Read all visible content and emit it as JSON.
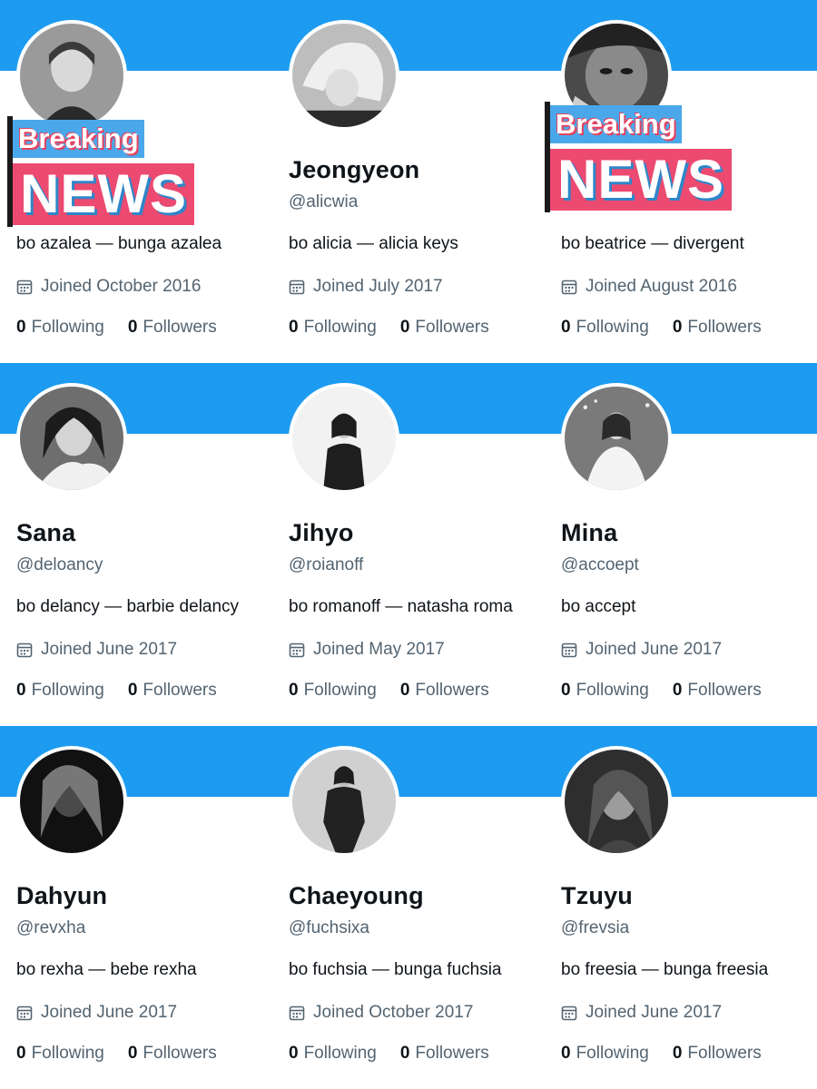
{
  "accent_color": "#1d9bf0",
  "overlay": {
    "breaking_label": "Breaking",
    "news_label": "NEWS"
  },
  "profiles": [
    {
      "name": "",
      "handle": "",
      "bio": "bo azalea — bunga azalea",
      "joined": "Joined October 2016",
      "following_count": "0",
      "following_label": "Following",
      "followers_count": "0",
      "followers_label": "Followers",
      "avatar_icon": "profile-photo"
    },
    {
      "name": "Jeongyeon",
      "handle": "@alicwia",
      "bio": "bo alicia — alicia keys",
      "joined": "Joined July 2017",
      "following_count": "0",
      "following_label": "Following",
      "followers_count": "0",
      "followers_label": "Followers",
      "avatar_icon": "profile-photo"
    },
    {
      "name": "",
      "handle": "",
      "bio": "bo beatrice — divergent",
      "joined": "Joined August 2016",
      "following_count": "0",
      "following_label": "Following",
      "followers_count": "0",
      "followers_label": "Followers",
      "avatar_icon": "profile-photo"
    },
    {
      "name": "Sana",
      "handle": "@deloancy",
      "bio": "bo delancy — barbie delancy",
      "joined": "Joined June 2017",
      "following_count": "0",
      "following_label": "Following",
      "followers_count": "0",
      "followers_label": "Followers",
      "avatar_icon": "profile-photo"
    },
    {
      "name": "Jihyo",
      "handle": "@roianoff",
      "bio": "bo romanoff — natasha roma",
      "joined": "Joined May 2017",
      "following_count": "0",
      "following_label": "Following",
      "followers_count": "0",
      "followers_label": "Followers",
      "avatar_icon": "profile-photo"
    },
    {
      "name": "Mina",
      "handle": "@accoept",
      "bio": "bo accept",
      "joined": "Joined June 2017",
      "following_count": "0",
      "following_label": "Following",
      "followers_count": "0",
      "followers_label": "Followers",
      "avatar_icon": "profile-photo"
    },
    {
      "name": "Dahyun",
      "handle": "@revxha",
      "bio": "bo rexha — bebe rexha",
      "joined": "Joined June 2017",
      "following_count": "0",
      "following_label": "Following",
      "followers_count": "0",
      "followers_label": "Followers",
      "avatar_icon": "profile-photo"
    },
    {
      "name": "Chaeyoung",
      "handle": "@fuchsixa",
      "bio": "bo fuchsia — bunga fuchsia",
      "joined": "Joined October 2017",
      "following_count": "0",
      "following_label": "Following",
      "followers_count": "0",
      "followers_label": "Followers",
      "avatar_icon": "profile-photo"
    },
    {
      "name": "Tzuyu",
      "handle": "@frevsia",
      "bio": "bo freesia — bunga freesia",
      "joined": "Joined June 2017",
      "following_count": "0",
      "following_label": "Following",
      "followers_count": "0",
      "followers_label": "Followers",
      "avatar_icon": "profile-photo"
    }
  ]
}
